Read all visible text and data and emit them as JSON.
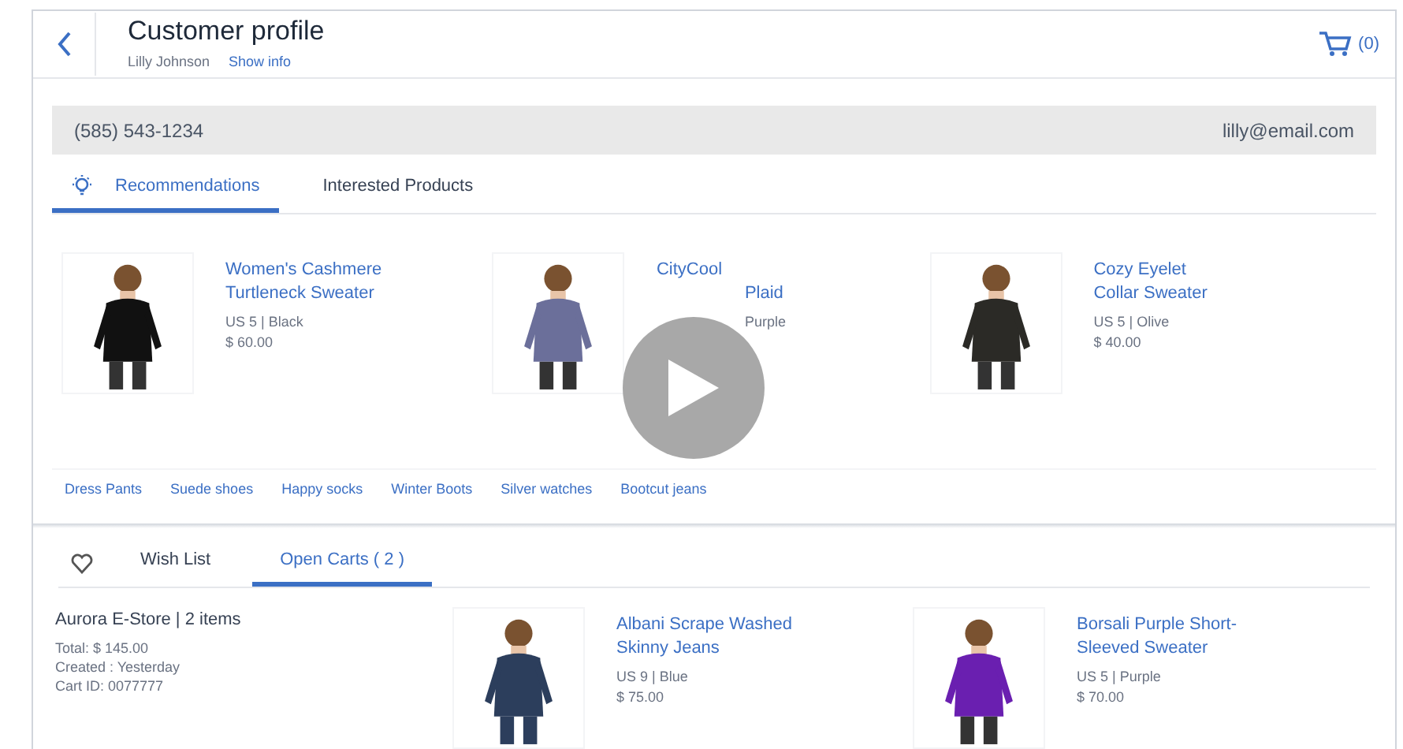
{
  "header": {
    "title": "Customer profile",
    "customer_name": "Lilly Johnson",
    "show_info_link": "Show info",
    "cart_count": "(0)"
  },
  "contact": {
    "phone": "(585) 543-1234",
    "email": "lilly@email.com"
  },
  "top_tabs": [
    {
      "label": "Recommendations",
      "selected": true
    },
    {
      "label": "Interested Products",
      "selected": false
    }
  ],
  "recommendations": [
    {
      "title_lines": [
        "Women's Cashmere",
        "Turtleneck Sweater"
      ],
      "meta": [
        "US 5 | Black",
        "$ 60.00"
      ]
    },
    {
      "title_lines": [
        "CityCool",
        "Plaid"
      ],
      "meta": [
        "Purple"
      ]
    },
    {
      "title_lines": [
        "Cozy Eyelet",
        "Collar Sweater"
      ],
      "meta": [
        "US 5 | Olive",
        "$ 40.00"
      ]
    }
  ],
  "tags": [
    "Dress Pants",
    "Suede shoes",
    "Happy socks",
    "Winter Boots",
    "Silver watches",
    "Bootcut jeans"
  ],
  "bottom_tabs": [
    {
      "label": "Wish List",
      "selected": false
    },
    {
      "label": "Open Carts ( 2 )",
      "selected": true
    }
  ],
  "cart": {
    "title": "Aurora E-Store | 2 items",
    "lines": [
      "Total: $ 145.00",
      "Created : Yesterday",
      "Cart ID: 0077777"
    ]
  },
  "cart_items": [
    {
      "title_lines": [
        "Albani Scrape Washed",
        "Skinny Jeans"
      ],
      "meta": [
        "US 9 | Blue",
        "$ 75.00"
      ]
    },
    {
      "title_lines": [
        "Borsali Purple Short-",
        "Sleeved Sweater"
      ],
      "meta": [
        "US 5 | Purple",
        "$ 70.00"
      ]
    }
  ],
  "video": {
    "kind": "play_overlay"
  }
}
